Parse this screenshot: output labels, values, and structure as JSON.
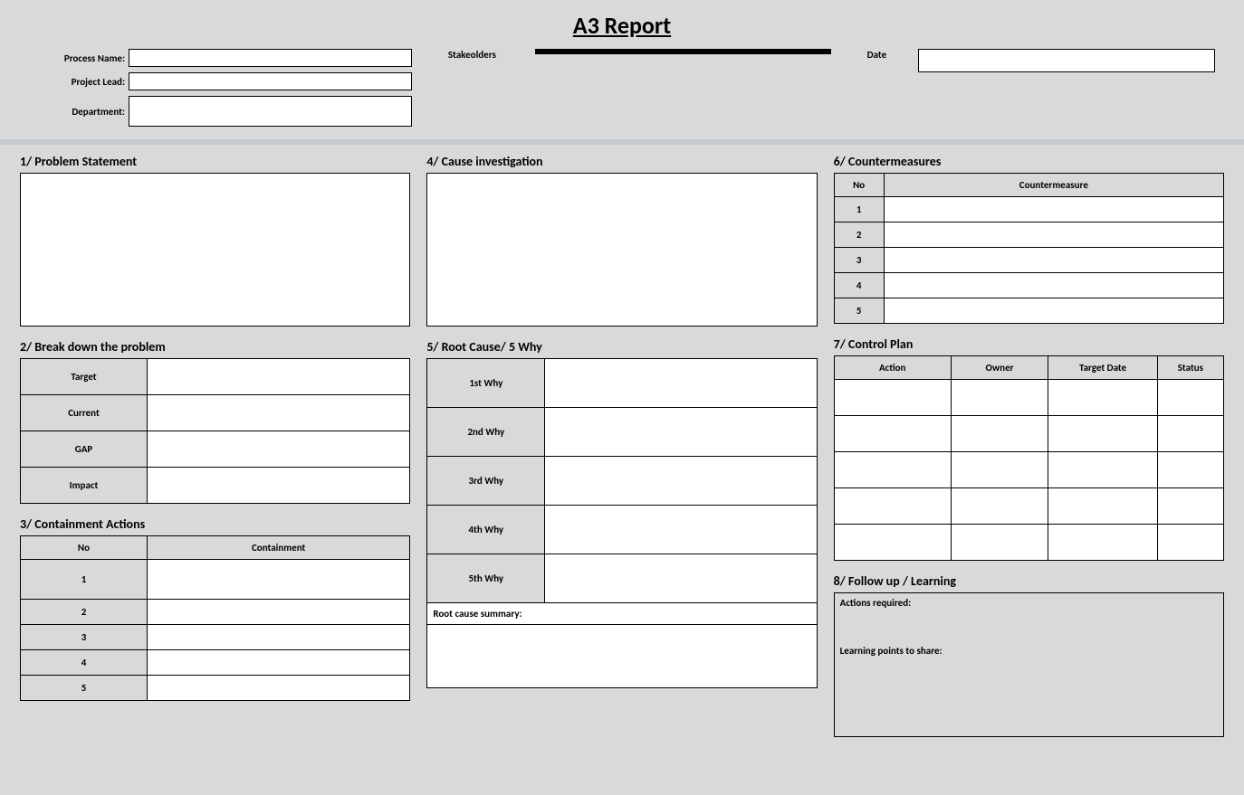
{
  "title": "A3 Report",
  "header": {
    "process_name_label": "Process Name:",
    "project_lead_label": "Project Lead:",
    "department_label": "Department:",
    "stakeholders_label": "Stakeolders",
    "date_label": "Date",
    "process_name": "",
    "project_lead": "",
    "department": "",
    "stakeholders": [
      "",
      "",
      "",
      "",
      ""
    ],
    "date": ""
  },
  "s1": {
    "title": "1/ Problem Statement",
    "text": ""
  },
  "s2": {
    "title": "2/ Break down the problem",
    "rows": [
      {
        "label": "Target",
        "value": ""
      },
      {
        "label": "Current",
        "value": ""
      },
      {
        "label": "GAP",
        "value": ""
      },
      {
        "label": "Impact",
        "value": ""
      }
    ]
  },
  "s3": {
    "title": "3/ Containment Actions",
    "col_no": "No",
    "col_containment": "Containment",
    "rows": [
      {
        "no": "1",
        "val": ""
      },
      {
        "no": "2",
        "val": ""
      },
      {
        "no": "3",
        "val": ""
      },
      {
        "no": "4",
        "val": ""
      },
      {
        "no": "5",
        "val": ""
      }
    ]
  },
  "s4": {
    "title": "4/ Cause investigation",
    "text": ""
  },
  "s5": {
    "title": "5/ Root Cause/ 5 Why",
    "whys": [
      {
        "label": "1st Why",
        "value": ""
      },
      {
        "label": "2nd Why",
        "value": ""
      },
      {
        "label": "3rd Why",
        "value": ""
      },
      {
        "label": "4th Why",
        "value": ""
      },
      {
        "label": "5th Why",
        "value": ""
      }
    ],
    "summary_label": "Root cause summary:",
    "summary": ""
  },
  "s6": {
    "title": "6/ Countermeasures",
    "col_no": "No",
    "col_cm": "Countermeasure",
    "rows": [
      {
        "no": "1",
        "val": ""
      },
      {
        "no": "2",
        "val": ""
      },
      {
        "no": "3",
        "val": ""
      },
      {
        "no": "4",
        "val": ""
      },
      {
        "no": "5",
        "val": ""
      }
    ]
  },
  "s7": {
    "title": "7/ Control Plan",
    "cols": {
      "action": "Action",
      "owner": "Owner",
      "target": "Target Date",
      "status": "Status"
    },
    "rows": [
      {
        "action": "",
        "owner": "",
        "target": "",
        "status": ""
      },
      {
        "action": "",
        "owner": "",
        "target": "",
        "status": ""
      },
      {
        "action": "",
        "owner": "",
        "target": "",
        "status": ""
      },
      {
        "action": "",
        "owner": "",
        "target": "",
        "status": ""
      },
      {
        "action": "",
        "owner": "",
        "target": "",
        "status": ""
      }
    ]
  },
  "s8": {
    "title": "8/ Follow up / Learning",
    "actions_label": "Actions required:",
    "learning_label": "Learning points to share:",
    "actions": "",
    "learning": ""
  }
}
